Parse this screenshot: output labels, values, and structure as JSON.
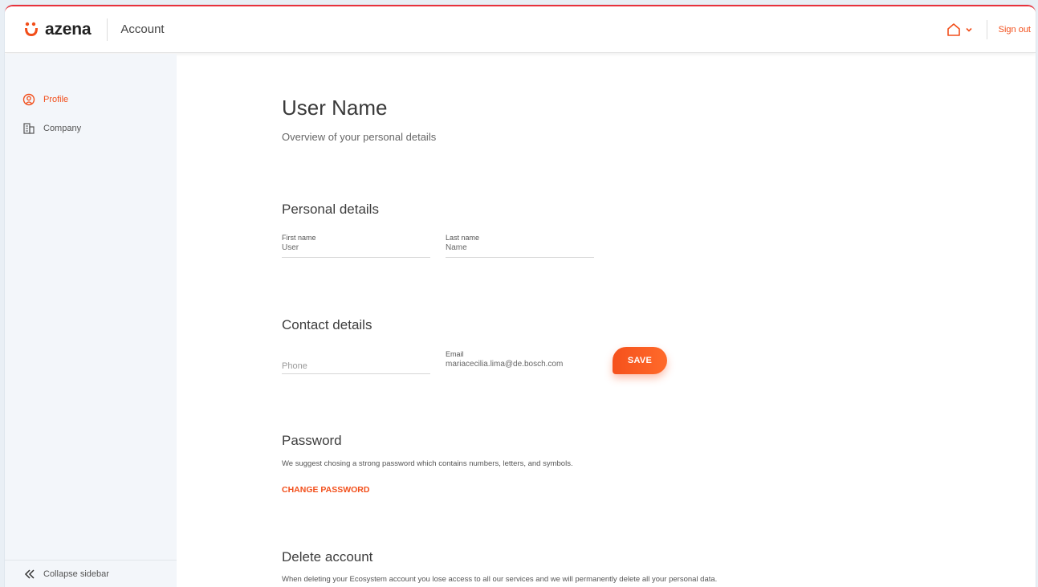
{
  "colors": {
    "accent": "#f24f1b",
    "topline": "#e8323c",
    "sidebar_bg": "#f3f6fa"
  },
  "header": {
    "brand": "azena",
    "section": "Account",
    "home_icon": "home-icon",
    "signout_label": "Sign out"
  },
  "sidebar": {
    "items": [
      {
        "label": "Profile",
        "icon": "profile-icon",
        "active": true
      },
      {
        "label": "Company",
        "icon": "building-icon",
        "active": false
      }
    ],
    "collapse_label": "Collapse sidebar"
  },
  "main": {
    "title": "User Name",
    "subtitle": "Overview of your personal details",
    "personal": {
      "heading": "Personal details",
      "first_name_label": "First name",
      "first_name_value": "User",
      "last_name_label": "Last name",
      "last_name_value": "Name"
    },
    "contact": {
      "heading": "Contact details",
      "phone_placeholder": "Phone",
      "email_label": "Email",
      "email_value": "mariacecilia.lima@de.bosch.com",
      "save_label": "SAVE"
    },
    "password": {
      "heading": "Password",
      "description": "We suggest chosing a strong password which contains numbers, letters, and symbols.",
      "change_label": "CHANGE PASSWORD"
    },
    "delete": {
      "heading": "Delete account",
      "description": "When deleting your Ecosystem account you lose access to all our services and we will permanently delete all your personal data."
    }
  }
}
